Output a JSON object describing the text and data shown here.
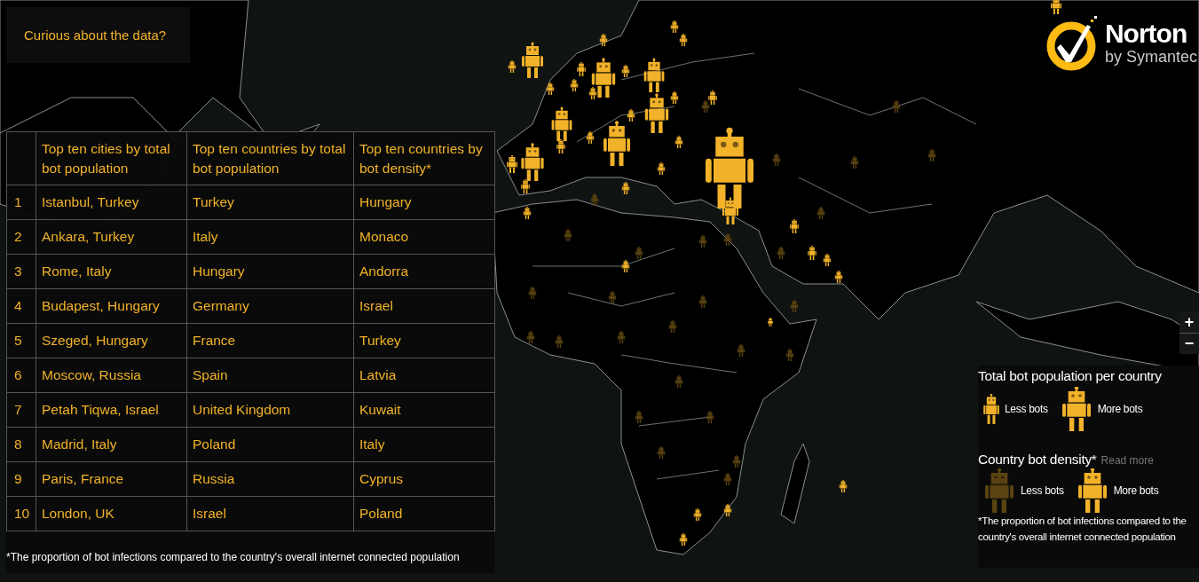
{
  "info_button": {
    "label": "Curious about the data?"
  },
  "logo": {
    "name": "Norton",
    "tagline": "by Symantec"
  },
  "table": {
    "columns": [
      "Top ten cities by total bot population",
      "Top ten countries by total bot population",
      "Top ten countries by bot density*"
    ],
    "rows": [
      {
        "rank": "1",
        "city": "Istanbul, Turkey",
        "country_total": "Turkey",
        "country_density": "Hungary"
      },
      {
        "rank": "2",
        "city": "Ankara, Turkey",
        "country_total": "Italy",
        "country_density": "Monaco"
      },
      {
        "rank": "3",
        "city": "Rome, Italy",
        "country_total": "Hungary",
        "country_density": "Andorra"
      },
      {
        "rank": "4",
        "city": "Budapest, Hungary",
        "country_total": "Germany",
        "country_density": "Israel"
      },
      {
        "rank": "5",
        "city": "Szeged, Hungary",
        "country_total": "France",
        "country_density": "Turkey"
      },
      {
        "rank": "6",
        "city": "Moscow, Russia",
        "country_total": "Spain",
        "country_density": "Latvia"
      },
      {
        "rank": "7",
        "city": "Petah Tiqwa, Israel",
        "country_total": "United Kingdom",
        "country_density": "Kuwait"
      },
      {
        "rank": "8",
        "city": "Madrid, Italy",
        "country_total": "Poland",
        "country_density": "Italy"
      },
      {
        "rank": "9",
        "city": "Paris, France",
        "country_total": "Russia",
        "country_density": "Cyprus"
      },
      {
        "rank": "10",
        "city": "London, UK",
        "country_total": "Israel",
        "country_density": "Poland"
      }
    ],
    "footnote": "*The proportion of bot infections compared to the country's overall internet connected population"
  },
  "zoom_controls": {
    "zoom_in": "+",
    "zoom_out": "−"
  },
  "legend": {
    "total_title": "Total bot population per country",
    "total_items": [
      {
        "kind": "small",
        "label": "Less bots"
      },
      {
        "kind": "large",
        "label": "More bots"
      }
    ],
    "density_title": "Country bot density*",
    "read_more": "Read more",
    "density_items": [
      {
        "kind": "dim",
        "label": "Less bots"
      },
      {
        "kind": "bright",
        "label": "More bots"
      }
    ],
    "footnote": "*The proportion of bot infections compared to the country's overall internet connected population"
  }
}
